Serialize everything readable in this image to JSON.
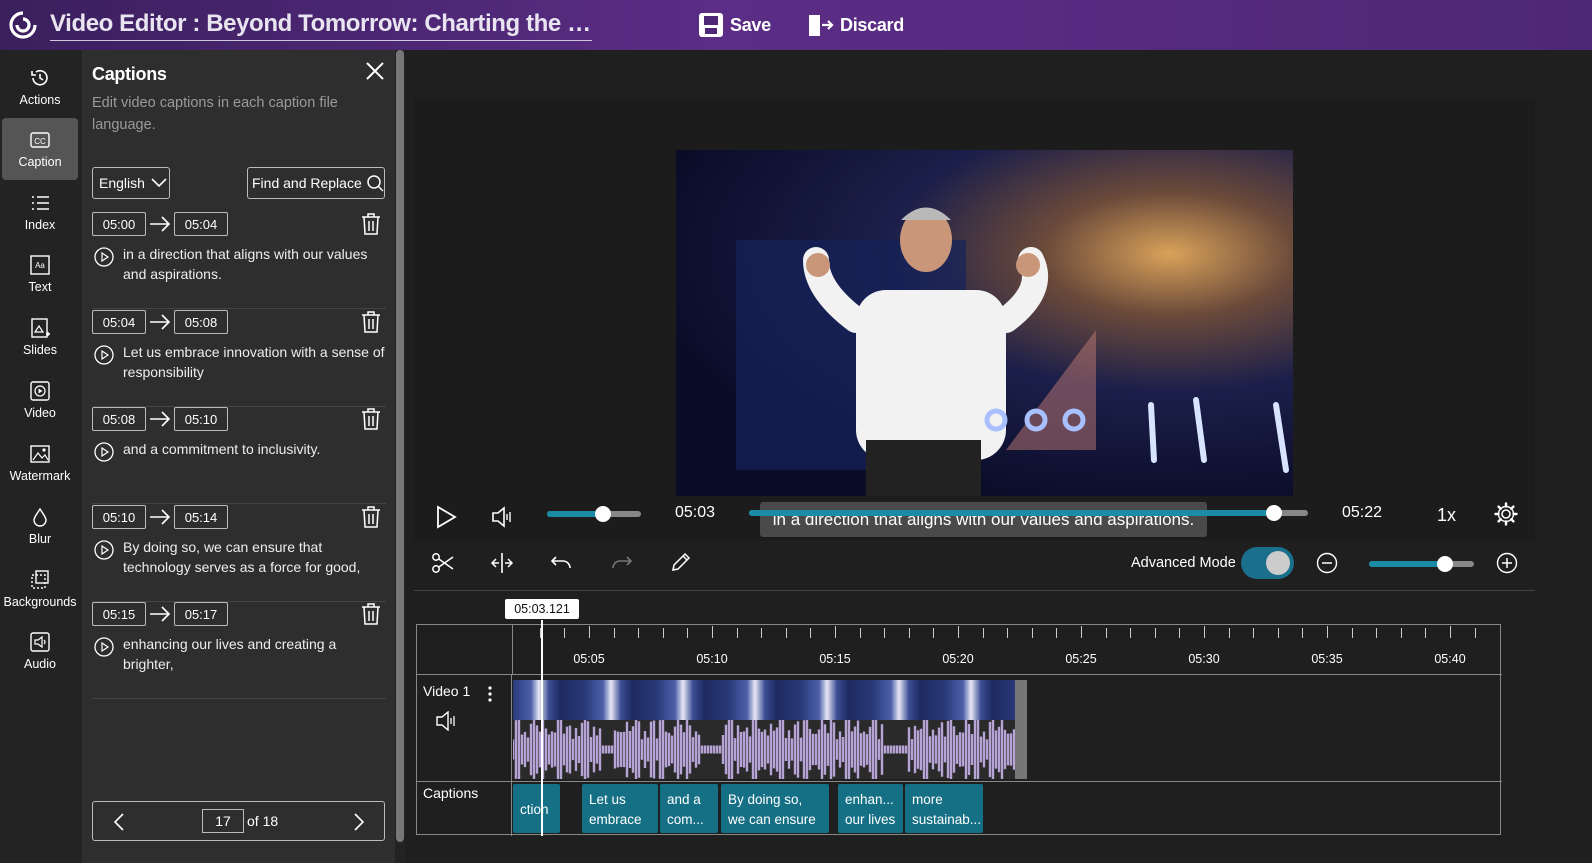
{
  "header": {
    "title": "Video Editor : Beyond Tomorrow: Charting the Fut...",
    "save_label": "Save",
    "discard_label": "Discard"
  },
  "nav": {
    "items": [
      {
        "label": "Actions",
        "icon": "history-icon"
      },
      {
        "label": "Caption",
        "icon": "closed-caption-icon"
      },
      {
        "label": "Index",
        "icon": "list-icon"
      },
      {
        "label": "Text",
        "icon": "text-icon"
      },
      {
        "label": "Slides",
        "icon": "slides-icon"
      },
      {
        "label": "Video",
        "icon": "video-icon"
      },
      {
        "label": "Watermark",
        "icon": "image-icon"
      },
      {
        "label": "Blur",
        "icon": "drop-icon"
      },
      {
        "label": "Backgrounds",
        "icon": "background-icon"
      },
      {
        "label": "Audio",
        "icon": "audio-icon"
      }
    ]
  },
  "captions_panel": {
    "title": "Captions",
    "description": "Edit video captions in each caption file language.",
    "language": "English",
    "find_replace_label": "Find and Replace",
    "items": [
      {
        "start": "05:00",
        "end": "05:04",
        "text": "in a direction that aligns with our values and aspirations."
      },
      {
        "start": "05:04",
        "end": "05:08",
        "text": "Let us embrace innovation with a sense of responsibility"
      },
      {
        "start": "05:08",
        "end": "05:10",
        "text": "and a commitment to inclusivity."
      },
      {
        "start": "05:10",
        "end": "05:14",
        "text": "By doing so, we can ensure that technology serves as a force for good,"
      },
      {
        "start": "05:15",
        "end": "05:17",
        "text": "enhancing our lives and creating a brighter,"
      }
    ],
    "pager": {
      "current": "17",
      "of_label": "of 18"
    }
  },
  "player": {
    "subtitle": "in a direction that aligns with our values and aspirations.",
    "current_time": "05:03",
    "total_time": "05:22",
    "speed": "1x",
    "volume": 0.6,
    "progress": 0.94,
    "advanced_mode_label": "Advanced Mode",
    "advanced_mode_on": true,
    "zoom": 0.72
  },
  "timeline": {
    "playhead_time": "05:03.121",
    "ruler_labels": [
      "05:05",
      "05:10",
      "05:15",
      "05:20",
      "05:25",
      "05:30",
      "05:35",
      "05:40"
    ],
    "tracks": {
      "video_label": "Video 1",
      "captions_label": "Captions"
    },
    "caption_clips": [
      {
        "text": "ction"
      },
      {
        "line1": "Let us",
        "line2": "embrace"
      },
      {
        "line1": "and a",
        "line2": "com..."
      },
      {
        "line1": "By doing so,",
        "line2": "we can ensure"
      },
      {
        "line1": "enhan...",
        "line2": "our lives"
      },
      {
        "line1": "more",
        "line2": "sustainab..."
      }
    ]
  },
  "colors": {
    "accent": "#1a8ca6",
    "header": "#5b2d86",
    "caption_clip": "#157085",
    "waveform": "#b7a4d6"
  }
}
